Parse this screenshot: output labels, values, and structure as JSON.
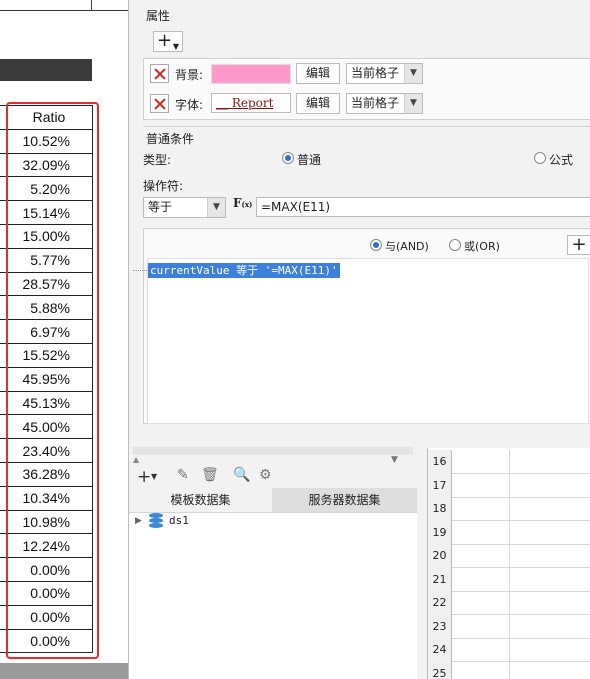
{
  "sheet": {
    "header": "Ratio",
    "ratios": [
      "10.52%",
      "32.09%",
      "5.20%",
      "15.14%",
      "15.00%",
      "5.77%",
      "28.57%",
      "5.88%",
      "6.97%",
      "15.52%",
      "45.95%",
      "45.13%",
      "45.00%",
      "23.40%",
      "36.28%",
      "10.34%",
      "10.98%",
      "12.24%",
      "0.00%",
      "0.00%",
      "0.00%",
      "0.00%"
    ]
  },
  "panel": {
    "properties_title": "属性",
    "rows": [
      {
        "label": "背景:",
        "edit": "编辑",
        "scope": "当前格子",
        "color": "#ff99cc"
      },
      {
        "label": "字体:",
        "preview": "Report",
        "edit": "编辑",
        "scope": "当前格子"
      }
    ],
    "condition_title": "普通条件",
    "type_label": "类型:",
    "type_options": [
      "普通",
      "公式"
    ],
    "operator_label": "操作符:",
    "operator_value": "等于",
    "formula_value": "=MAX(E11)",
    "logic_options": [
      "与(AND)",
      "或(OR)"
    ],
    "condition_item": "currentValue 等于 '=MAX(E11)'",
    "dataset_tabs": [
      "模板数据集",
      "服务器数据集"
    ],
    "dataset_items": [
      "ds1"
    ],
    "row_numbers": [
      "16",
      "17",
      "18",
      "19",
      "20",
      "21",
      "22",
      "23",
      "24",
      "25"
    ]
  },
  "colors": {
    "highlight_border": "#e52d2d",
    "selection": "#3c7fdc",
    "radio_accent": "#2b6fd6"
  }
}
